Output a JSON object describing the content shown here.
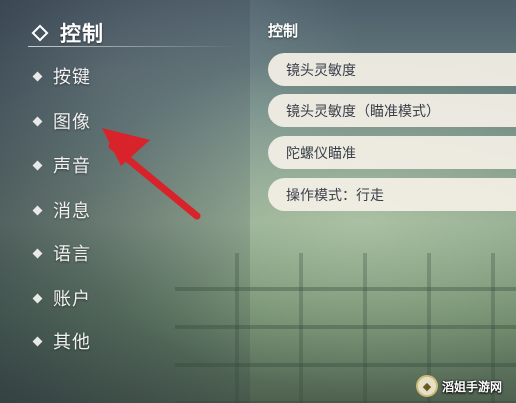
{
  "sidebar": {
    "items": [
      {
        "label": "控制",
        "active": true
      },
      {
        "label": "按键",
        "active": false
      },
      {
        "label": "图像",
        "active": false
      },
      {
        "label": "声音",
        "active": false
      },
      {
        "label": "消息",
        "active": false
      },
      {
        "label": "语言",
        "active": false
      },
      {
        "label": "账户",
        "active": false
      },
      {
        "label": "其他",
        "active": false
      }
    ]
  },
  "panel": {
    "title": "控制",
    "options": [
      "镜头灵敏度",
      "镜头灵敏度（瞄准模式）",
      "陀螺仪瞄准",
      "操作模式：行走"
    ]
  },
  "annotation": {
    "arrow_color": "#d8232a",
    "points_to": "图像"
  },
  "watermark": {
    "text": "滔姐手游网"
  }
}
